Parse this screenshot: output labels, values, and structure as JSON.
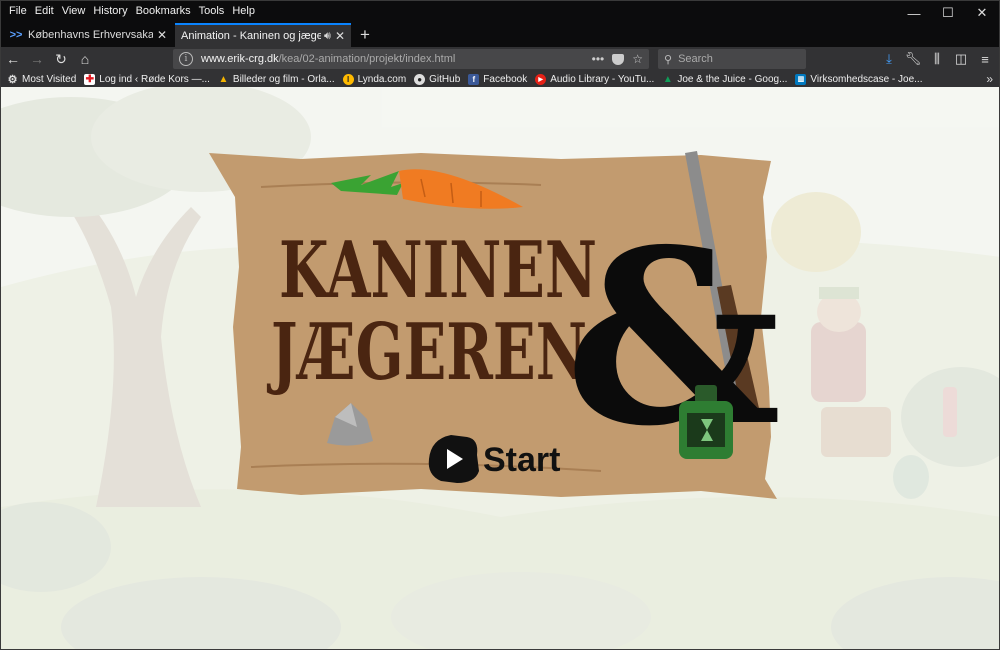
{
  "menu": [
    "File",
    "Edit",
    "View",
    "History",
    "Bookmarks",
    "Tools",
    "Help"
  ],
  "window_controls": {
    "minimize": "—",
    "maximize": "☐",
    "close": "✕"
  },
  "tabs": [
    {
      "title": "Københavns Erhvervsakademi /",
      "active": false
    },
    {
      "title": "Animation - Kaninen og jægere",
      "active": true
    }
  ],
  "new_tab": "+",
  "address": {
    "host": "www.erik-crg.dk",
    "path": "/kea/02-animation/projekt/index.html",
    "actions": "•••"
  },
  "search": {
    "placeholder": "Search"
  },
  "bookmarks": [
    {
      "label": "Most Visited",
      "icon": "gear-icon"
    },
    {
      "label": "Log ind ‹ Røde Kors —...",
      "icon": "red-cross-icon"
    },
    {
      "label": "Billeder og film - Orla...",
      "icon": "google-drive-icon"
    },
    {
      "label": "Lynda.com",
      "icon": "lynda-icon"
    },
    {
      "label": "GitHub",
      "icon": "github-icon"
    },
    {
      "label": "Facebook",
      "icon": "facebook-icon"
    },
    {
      "label": "Audio Library - YouTu...",
      "icon": "youtube-icon"
    },
    {
      "label": "Joe & the Juice - Goog...",
      "icon": "google-drive-icon"
    },
    {
      "label": "Virksomhedscase - Joe...",
      "icon": "trello-icon"
    }
  ],
  "game": {
    "title_line1": "KANINEN",
    "title_line2": "JÆGEREN",
    "ampersand": "&",
    "start_label": "Start"
  },
  "colors": {
    "accent": "#0a84ff",
    "sign": "#c49a6c",
    "title": "#4a2511",
    "toolbar": "#323234"
  }
}
